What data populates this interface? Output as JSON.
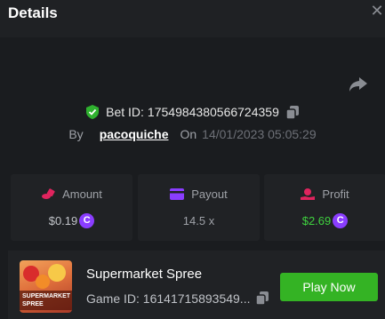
{
  "header": {
    "title": "Details",
    "close_icon": "close-icon"
  },
  "share_icon": "share-icon",
  "bet": {
    "label": "Bet ID:",
    "id": "1754984380566724359",
    "verified_icon": "shield-check-icon",
    "copy_icon": "copy-icon"
  },
  "by_row": {
    "by_label": "By",
    "username": "pacoquiche",
    "on_label": "On",
    "datetime": "14/01/2023 05:05:29"
  },
  "stats": {
    "amount": {
      "label": "Amount",
      "value": "$0.19",
      "icon": "coins-icon",
      "icon_color": "#e0245e"
    },
    "payout": {
      "label": "Payout",
      "value": "14.5 x",
      "icon": "card-icon",
      "icon_color": "#8a3dff"
    },
    "profit": {
      "label": "Profit",
      "value": "$2.69",
      "icon": "hand-coin-icon",
      "icon_color": "#e0245e",
      "value_color": "#3fd13f"
    },
    "currency_symbol": "C"
  },
  "game": {
    "name": "Supermarket Spree",
    "id_label": "Game ID:",
    "id": "16141715893549...",
    "thumb_text": "SUPERMARKET SPREE",
    "play_label": "Play Now",
    "play_color": "#34b324"
  }
}
